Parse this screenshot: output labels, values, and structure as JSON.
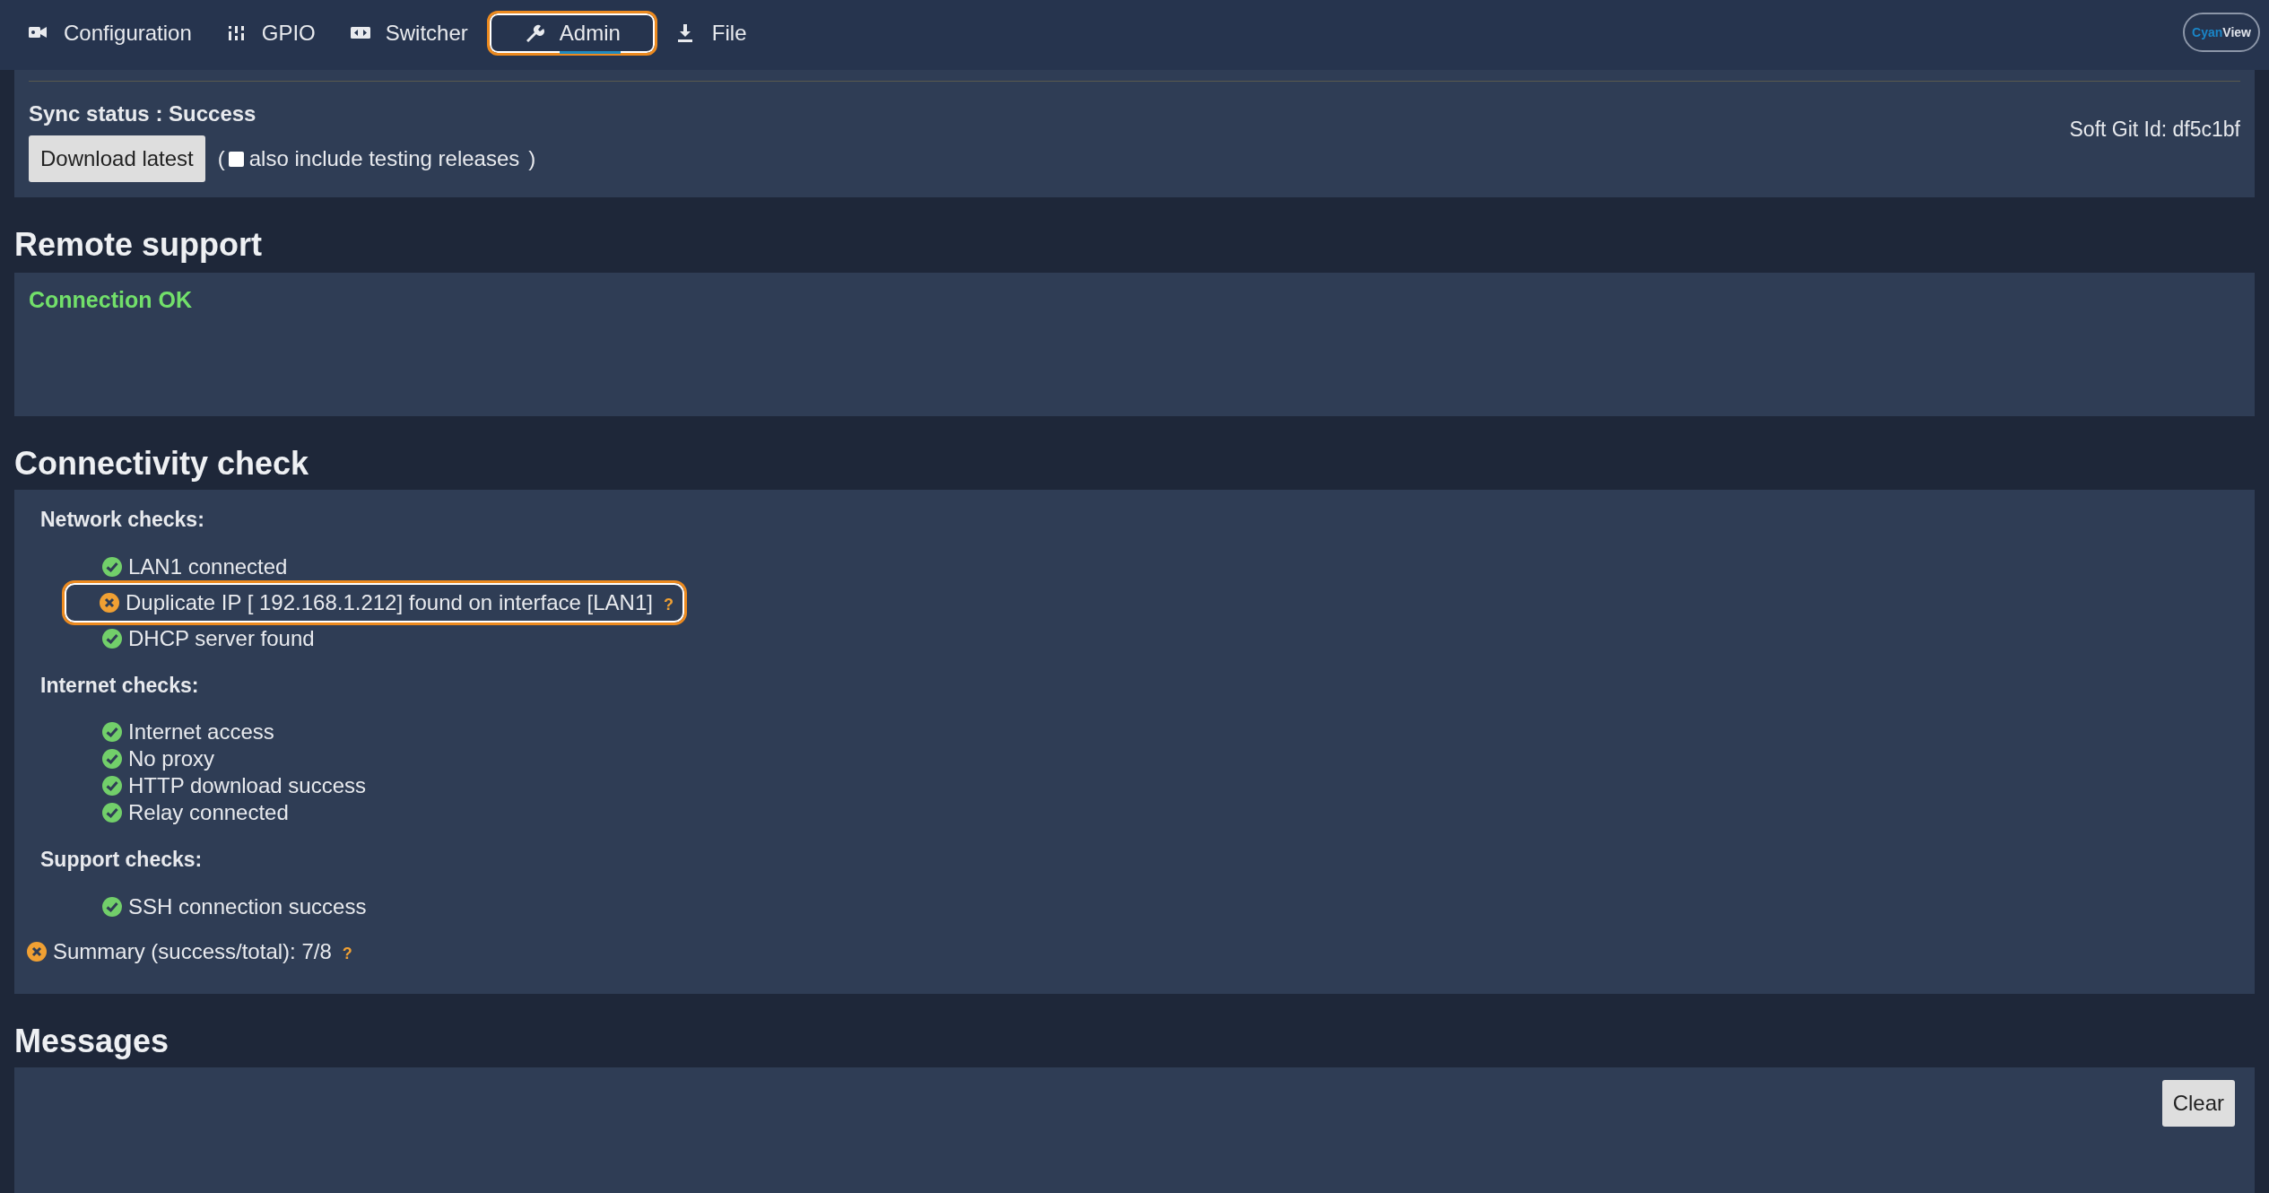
{
  "nav": {
    "tabs": [
      {
        "label": "Configuration",
        "kind": "camera",
        "selected": false,
        "highlighted": false
      },
      {
        "label": "GPIO",
        "kind": "sliders",
        "selected": false,
        "highlighted": false
      },
      {
        "label": "Switcher",
        "kind": "switcher",
        "selected": false,
        "highlighted": false
      },
      {
        "label": "Admin",
        "kind": "wrench",
        "selected": true,
        "highlighted": true
      },
      {
        "label": "File",
        "kind": "download",
        "selected": false,
        "highlighted": false
      }
    ],
    "logo": {
      "part_1": "Cyan",
      "part_2": "View"
    }
  },
  "sync": {
    "status": "Sync status : Success",
    "download_button": "Download latest",
    "open_paren": "(",
    "testing_option": {
      "label": "also include testing releases",
      "checked": false
    },
    "close_paren": ")",
    "git_id": "Soft Git Id: df5c1bf"
  },
  "remote_support": {
    "title": "Remote support",
    "status": "Connection OK",
    "ok": true
  },
  "connectivity": {
    "title": "Connectivity check",
    "groups": [
      {
        "label": "Network checks:",
        "items": [
          {
            "text": "LAN1 connected",
            "passed": true,
            "highlighted": false
          },
          {
            "text": "Duplicate IP [ 192.168.1.212] found on interface [LAN1]",
            "passed": false,
            "help": "?",
            "highlighted": true
          },
          {
            "text": "DHCP server found",
            "passed": true,
            "highlighted": false
          }
        ]
      },
      {
        "label": "Internet checks:",
        "items": [
          {
            "text": "Internet access",
            "passed": true,
            "highlighted": false
          },
          {
            "text": "No proxy",
            "passed": true,
            "highlighted": false
          },
          {
            "text": "HTTP download success",
            "passed": true,
            "highlighted": false
          },
          {
            "text": "Relay connected",
            "passed": true,
            "highlighted": false
          }
        ]
      },
      {
        "label": "Support checks:",
        "items": [
          {
            "text": "SSH connection success",
            "passed": true,
            "highlighted": false
          }
        ]
      }
    ],
    "summary": {
      "text": "Summary (success/total): 7/8",
      "passed": false,
      "help": "?"
    }
  },
  "messages": {
    "title": "Messages",
    "clear_button": "Clear"
  }
}
